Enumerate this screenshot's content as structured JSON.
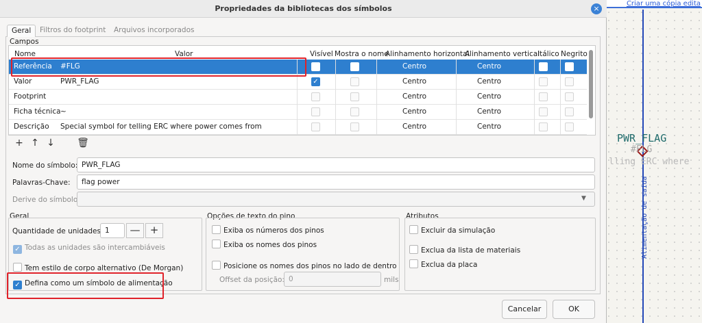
{
  "dialog": {
    "title": "Propriedades da bibliotecas dos símbolos",
    "close_icon": "×",
    "tabs": [
      "Geral",
      "Filtros do footprint",
      "Arquivos incorporados"
    ]
  },
  "fields": {
    "group_title": "Campos",
    "columns": [
      "Nome",
      "Valor",
      "Visível",
      "Mostra o nome",
      "Alinhamento horizontal",
      "Alinhamento vertical",
      "Itálico",
      "Negrito"
    ],
    "rows": [
      {
        "name": "Referência",
        "value": "#FLG",
        "visible": false,
        "show_name": false,
        "h_align": "Centro",
        "v_align": "Centro",
        "italic": false,
        "bold": false,
        "selected": true
      },
      {
        "name": "Valor",
        "value": "PWR_FLAG",
        "visible": true,
        "show_name": false,
        "h_align": "Centro",
        "v_align": "Centro",
        "italic": false,
        "bold": false,
        "selected": false
      },
      {
        "name": "Footprint",
        "value": "",
        "visible": false,
        "show_name": false,
        "h_align": "Centro",
        "v_align": "Centro",
        "italic": false,
        "bold": false,
        "selected": false
      },
      {
        "name": "Ficha técnica",
        "value": "~",
        "visible": false,
        "show_name": false,
        "h_align": "Centro",
        "v_align": "Centro",
        "italic": false,
        "bold": false,
        "selected": false
      },
      {
        "name": "Descrição",
        "value": "Special symbol for telling ERC where power comes from",
        "visible": false,
        "show_name": false,
        "h_align": "Centro",
        "v_align": "Centro",
        "italic": false,
        "bold": false,
        "selected": false
      }
    ],
    "toolbar": {
      "add": "+",
      "up": "↑",
      "down": "↓",
      "delete": "🗑"
    }
  },
  "symbol": {
    "name_label": "Nome do símbolo:",
    "name_value": "PWR_FLAG",
    "keywords_label": "Palavras-Chave:",
    "keywords_value": "flag power",
    "derive_label": "Derive do símbolo:",
    "derive_value": ""
  },
  "general": {
    "title": "Geral",
    "units_label": "Quantidade de unidades:",
    "units_value": "1",
    "minus": "—",
    "plus": "+",
    "interchangeable_label": "Todas as unidades são intercambiáveis",
    "interchangeable_checked": true,
    "demorgan_label": "Tem estilo de corpo alternativo (De Morgan)",
    "demorgan_checked": false,
    "power_label": "Defina como um símbolo de alimentação",
    "power_checked": true
  },
  "pin_text": {
    "title": "Opções de texto do pino",
    "show_numbers_label": "Exiba os números dos pinos",
    "show_names_label": "Exiba os nomes dos pinos",
    "names_inside_label": "Posicione os nomes dos pinos no lado de dentro",
    "offset_label": "Offset da posição:",
    "offset_value": "0",
    "offset_unit": "mils"
  },
  "attributes": {
    "title": "Atributos",
    "exclude_sim_label": "Excluir da simulação",
    "exclude_bom_label": "Exclua da lista de materiais",
    "exclude_board_label": "Exclua da placa"
  },
  "buttons": {
    "cancel": "Cancelar",
    "ok": "OK"
  },
  "schematic": {
    "link_text": "Criar uma cópia edita",
    "symbol_name": "PWR_FLAG",
    "reference": "#FLG",
    "description_fragment": "lling ERC where",
    "vertical_label": "Alimentação de saída"
  },
  "colors": {
    "selection": "#2e7fcf",
    "highlight_box": "#e0222a",
    "wire": "#2348b8"
  }
}
